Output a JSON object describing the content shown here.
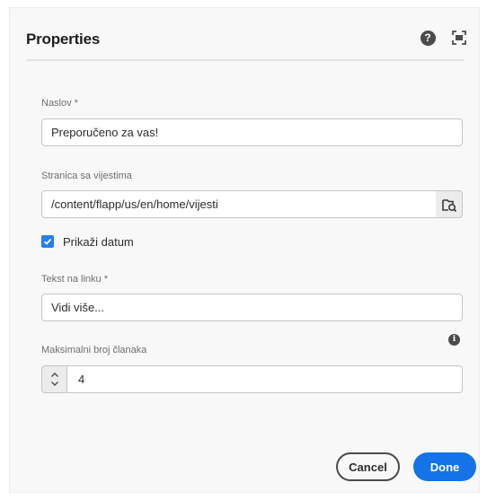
{
  "dialog": {
    "title": "Properties",
    "help_icon": "help-icon",
    "fullscreen_icon": "fullscreen-icon"
  },
  "fields": {
    "naslov": {
      "label": "Naslov *",
      "value": "Preporučeno za vas!"
    },
    "stranica": {
      "label": "Stranica sa vijestima",
      "value": "/content/flapp/us/en/home/vijesti",
      "browse_icon": "folder-search-icon"
    },
    "prikazi_datum": {
      "label": "Prikaži datum",
      "checked": true
    },
    "tekst_linka": {
      "label": "Tekst na linku *",
      "value": "Vidi više..."
    },
    "max_clanaka": {
      "label": "Maksimalni broj članaka",
      "value": "4",
      "info_icon": "info-icon"
    }
  },
  "footer": {
    "cancel_label": "Cancel",
    "done_label": "Done"
  },
  "colors": {
    "accent": "#1473e6",
    "checkbox": "#2680eb",
    "background": "#f8f8f8"
  }
}
